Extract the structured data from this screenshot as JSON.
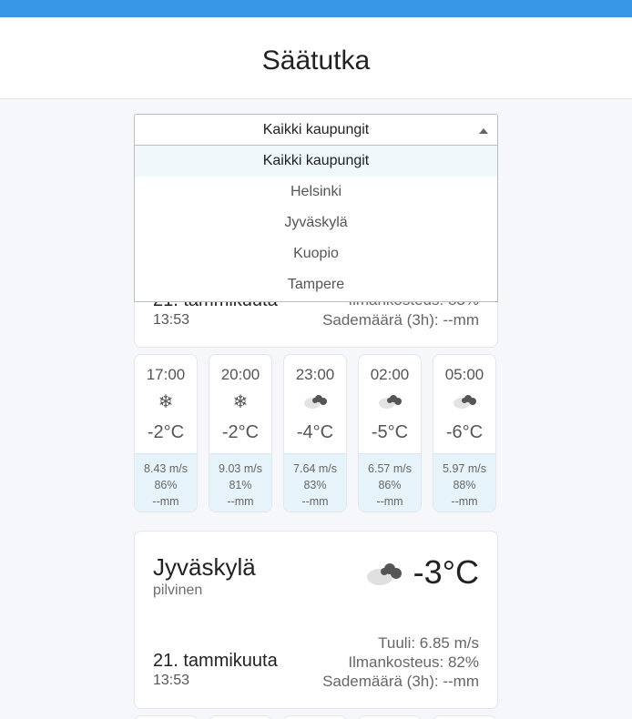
{
  "app": {
    "title": "Säätutka"
  },
  "colors": {
    "topbar": "#3897e6",
    "tile_bottom": "#e6f3fb"
  },
  "select": {
    "value": "Kaikki kaupungit",
    "options": [
      "Kaikki kaupungit",
      "Helsinki",
      "Jyväskylä",
      "Kuopio",
      "Tampere"
    ]
  },
  "cards": [
    {
      "name": "",
      "date": "21. tammikuuta",
      "time": "13:53",
      "humidity": "Ilmankosteus: 83%",
      "rain": "Sademäärä (3h): --mm"
    },
    {
      "name": "Jyväskylä",
      "description": "pilvinen",
      "icon": "cloud-icon",
      "temp": "-3°C",
      "date": "21. tammikuuta",
      "time": "13:53",
      "wind": "Tuuli: 6.85 m/s",
      "humidity": "Ilmankosteus: 82%",
      "rain": "Sademäärä (3h): --mm"
    }
  ],
  "forecast": [
    {
      "time": "17:00",
      "icon": "snowflake-icon",
      "temp": "-2°C",
      "wind": "8.43 m/s",
      "humidity": "86%",
      "rain": "--mm"
    },
    {
      "time": "20:00",
      "icon": "snowflake-icon",
      "temp": "-2°C",
      "wind": "9.03 m/s",
      "humidity": "81%",
      "rain": "--mm"
    },
    {
      "time": "23:00",
      "icon": "cloud-icon",
      "temp": "-4°C",
      "wind": "7.64 m/s",
      "humidity": "83%",
      "rain": "--mm"
    },
    {
      "time": "02:00",
      "icon": "cloud-icon",
      "temp": "-5°C",
      "wind": "6.57 m/s",
      "humidity": "86%",
      "rain": "--mm"
    },
    {
      "time": "05:00",
      "icon": "cloud-icon",
      "temp": "-6°C",
      "wind": "5.97 m/s",
      "humidity": "88%",
      "rain": "--mm"
    }
  ]
}
